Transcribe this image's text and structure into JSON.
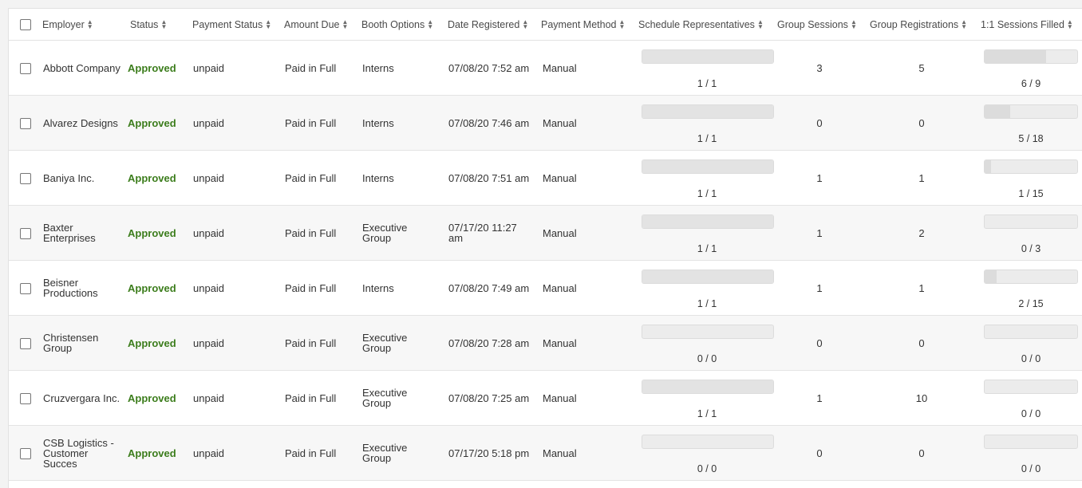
{
  "columns": [
    {
      "label": "Employer"
    },
    {
      "label": "Status"
    },
    {
      "label": "Payment Status"
    },
    {
      "label": "Amount Due"
    },
    {
      "label": "Booth Options"
    },
    {
      "label": "Date Registered"
    },
    {
      "label": "Payment Method"
    },
    {
      "label": "Schedule Representatives"
    },
    {
      "label": "Group Sessions"
    },
    {
      "label": "Group Registrations"
    },
    {
      "label": "1:1 Sessions Filled"
    }
  ],
  "rows": [
    {
      "employer": "Abbott Company",
      "status": "Approved",
      "payment_status": "unpaid",
      "amount_due": "Paid in Full",
      "booth": "Interns",
      "date": "07/08/20 7:52 am",
      "method": "Manual",
      "reps": "1 / 1",
      "reps_fill": 1.0,
      "group_sessions": "3",
      "group_regs": "5",
      "one_one": "6 / 9",
      "one_one_fill": 0.667
    },
    {
      "employer": "Alvarez Designs",
      "status": "Approved",
      "payment_status": "unpaid",
      "amount_due": "Paid in Full",
      "booth": "Interns",
      "date": "07/08/20 7:46 am",
      "method": "Manual",
      "reps": "1 / 1",
      "reps_fill": 1.0,
      "group_sessions": "0",
      "group_regs": "0",
      "one_one": "5 / 18",
      "one_one_fill": 0.278
    },
    {
      "employer": "Baniya Inc.",
      "status": "Approved",
      "payment_status": "unpaid",
      "amount_due": "Paid in Full",
      "booth": "Interns",
      "date": "07/08/20 7:51 am",
      "method": "Manual",
      "reps": "1 / 1",
      "reps_fill": 1.0,
      "group_sessions": "1",
      "group_regs": "1",
      "one_one": "1 / 15",
      "one_one_fill": 0.067
    },
    {
      "employer": "Baxter Enterprises",
      "status": "Approved",
      "payment_status": "unpaid",
      "amount_due": "Paid in Full",
      "booth": "Executive Group",
      "date": "07/17/20 11:27 am",
      "method": "Manual",
      "reps": "1 / 1",
      "reps_fill": 1.0,
      "group_sessions": "1",
      "group_regs": "2",
      "one_one": "0 / 3",
      "one_one_fill": 0
    },
    {
      "employer": "Beisner Productions",
      "status": "Approved",
      "payment_status": "unpaid",
      "amount_due": "Paid in Full",
      "booth": "Interns",
      "date": "07/08/20 7:49 am",
      "method": "Manual",
      "reps": "1 / 1",
      "reps_fill": 1.0,
      "group_sessions": "1",
      "group_regs": "1",
      "one_one": "2 / 15",
      "one_one_fill": 0.133
    },
    {
      "employer": "Christensen Group",
      "status": "Approved",
      "payment_status": "unpaid",
      "amount_due": "Paid in Full",
      "booth": "Executive Group",
      "date": "07/08/20 7:28 am",
      "method": "Manual",
      "reps": "0 / 0",
      "reps_fill": 0,
      "group_sessions": "0",
      "group_regs": "0",
      "one_one": "0 / 0",
      "one_one_fill": 0
    },
    {
      "employer": "Cruzvergara Inc.",
      "status": "Approved",
      "payment_status": "unpaid",
      "amount_due": "Paid in Full",
      "booth": "Executive Group",
      "date": "07/08/20 7:25 am",
      "method": "Manual",
      "reps": "1 / 1",
      "reps_fill": 1.0,
      "group_sessions": "1",
      "group_regs": "10",
      "one_one": "0 / 0",
      "one_one_fill": 0
    },
    {
      "employer": "CSB Logistics - Customer Succes",
      "status": "Approved",
      "payment_status": "unpaid",
      "amount_due": "Paid in Full",
      "booth": "Executive Group",
      "date": "07/17/20 5:18 pm",
      "method": "Manual",
      "reps": "0 / 0",
      "reps_fill": 0,
      "group_sessions": "0",
      "group_regs": "0",
      "one_one": "0 / 0",
      "one_one_fill": 0
    }
  ]
}
